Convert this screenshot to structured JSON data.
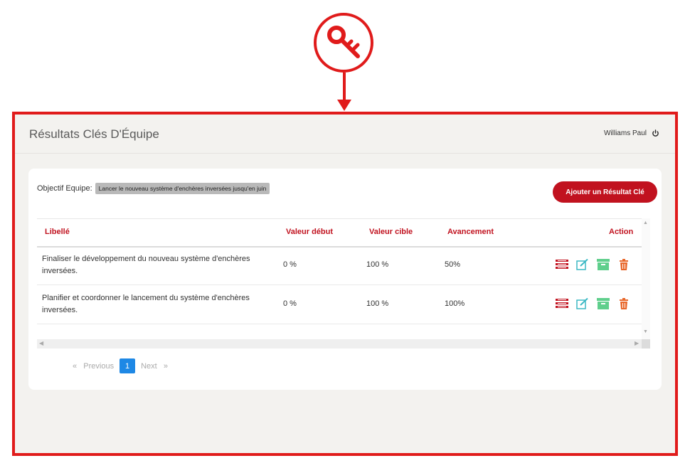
{
  "header": {
    "title": "Résultats Clés D'Équipe",
    "user_name": "Williams Paul"
  },
  "objective": {
    "label": "Objectif Equipe:",
    "value": "Lancer le nouveau système d'enchères inversées jusqu'en juin"
  },
  "add_button_label": "Ajouter un Résultat Clé",
  "table": {
    "columns": [
      "Libellé",
      "Valeur début",
      "Valeur cible",
      "Avancement",
      "Action"
    ],
    "rows": [
      {
        "label": "Finaliser le développement du nouveau système d'enchères inversées.",
        "start": "0 %",
        "target": "100 %",
        "progress": "50%"
      },
      {
        "label": "Planifier et coordonner le lancement du système d'enchères inversées.",
        "start": "0 %",
        "target": "100 %",
        "progress": "100%"
      }
    ]
  },
  "pagination": {
    "previous_label": "Previous",
    "current_page": "1",
    "next_label": "Next",
    "prev_glyph": "«",
    "next_glyph": "»"
  },
  "icons": {
    "badge": "key-icon",
    "power": "power-icon",
    "row_actions": [
      "list-icon",
      "edit-icon",
      "archive-icon",
      "trash-icon"
    ]
  },
  "colors": {
    "accent": "#c1121f",
    "frame": "#e01b1b",
    "page_active": "#1e88e5",
    "edit_icon": "#3bb8c4",
    "archive_icon": "#5fcf8c",
    "trash_icon": "#e8672a"
  }
}
